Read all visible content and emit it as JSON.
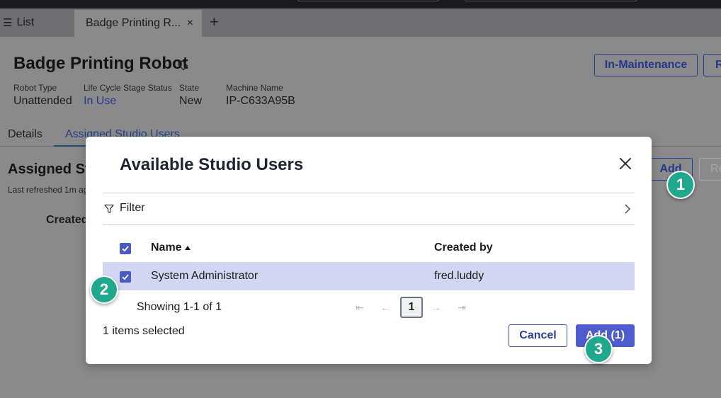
{
  "tabs": {
    "list_label": "List",
    "active_label": "Badge Printing R...",
    "close_glyph": "×",
    "add_glyph": "+"
  },
  "robot": {
    "title": "Badge Printing Robot",
    "buttons": {
      "maintenance": "In-Maintenance",
      "r": "R"
    },
    "meta": [
      {
        "label": "Robot Type",
        "value": "Unattended"
      },
      {
        "label": "Life Cycle Stage Status",
        "value": "In Use"
      },
      {
        "label": "State",
        "value": "New"
      },
      {
        "label": "Machine Name",
        "value": "IP-C633A95B"
      }
    ]
  },
  "detail_tabs": {
    "details": "Details",
    "assigned": "Assigned Studio Users"
  },
  "section": {
    "title": "Assigned Stu",
    "refreshed": "Last refreshed 1m ag",
    "column_created": "Created",
    "add_button": "Add",
    "re_button": "Re"
  },
  "modal": {
    "title": "Available Studio Users",
    "filter_label": "Filter",
    "columns": {
      "name": "Name",
      "created_by": "Created by"
    },
    "rows": [
      {
        "name": "System Administrator",
        "created_by": "fred.luddy",
        "selected": true
      }
    ],
    "pagination": {
      "showing": "Showing 1-1 of 1",
      "current_page": "1",
      "first": "⇤",
      "prev": "←",
      "next": "→",
      "last": "⇥"
    },
    "selected_count": "1 items selected",
    "cancel_label": "Cancel",
    "add_label": "Add (1)"
  },
  "markers": [
    "1",
    "2",
    "3"
  ],
  "colors": {
    "accent": "#4e5ccd",
    "row_selected": "#d3d6f3",
    "marker": "#1fa88d",
    "overlay": "#8a8a8a"
  }
}
